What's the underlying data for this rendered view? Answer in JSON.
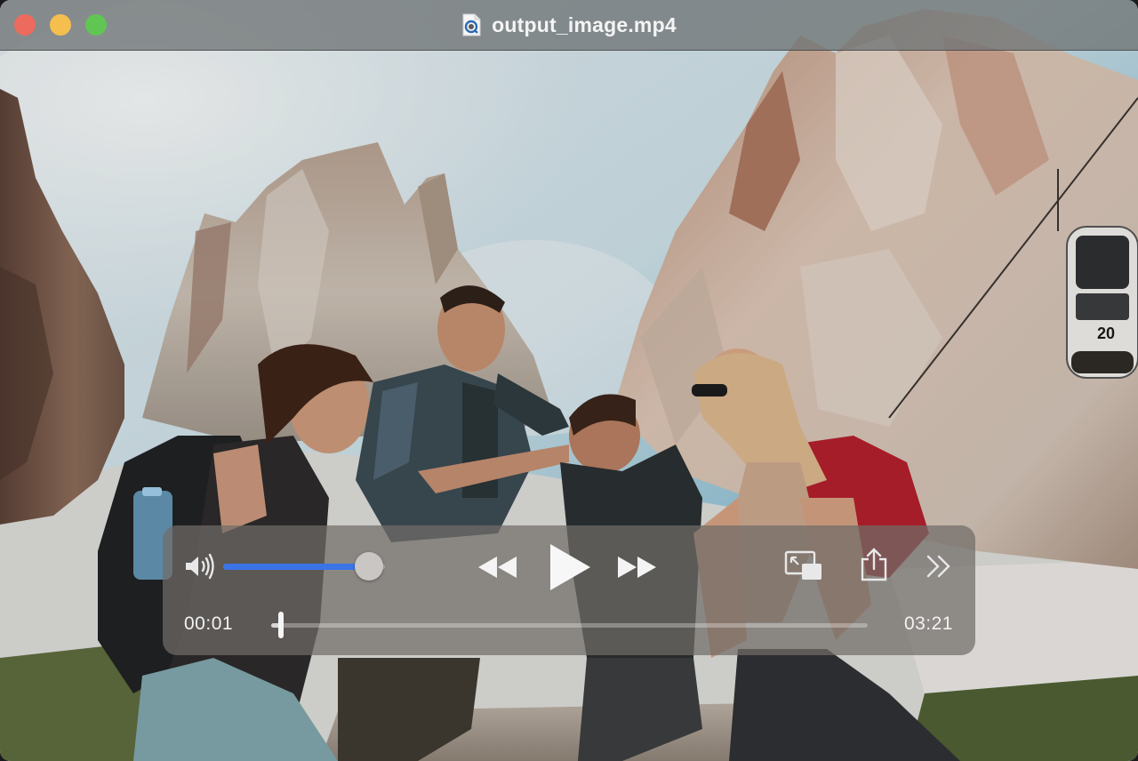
{
  "window": {
    "title": "output_image.mp4",
    "title_icon": "quicktime-file-icon"
  },
  "traffic_lights": {
    "close_color": "#ec6a5e",
    "minimize_color": "#f4bf4f",
    "zoom_color": "#61c554"
  },
  "video": {
    "cable_car_number": "20"
  },
  "controls": {
    "volume_level": 0.9,
    "volume_icon": "speaker-wave-icon",
    "rewind_icon": "rewind-icon",
    "play_icon": "play-icon",
    "fast_forward_icon": "fast-forward-icon",
    "pip_icon": "picture-in-picture-icon",
    "share_icon": "share-icon",
    "more_icon": "chevron-double-right-icon",
    "current_time": "00:01",
    "duration": "03:21",
    "progress": 0.016,
    "accent_color": "#3a74e6"
  }
}
